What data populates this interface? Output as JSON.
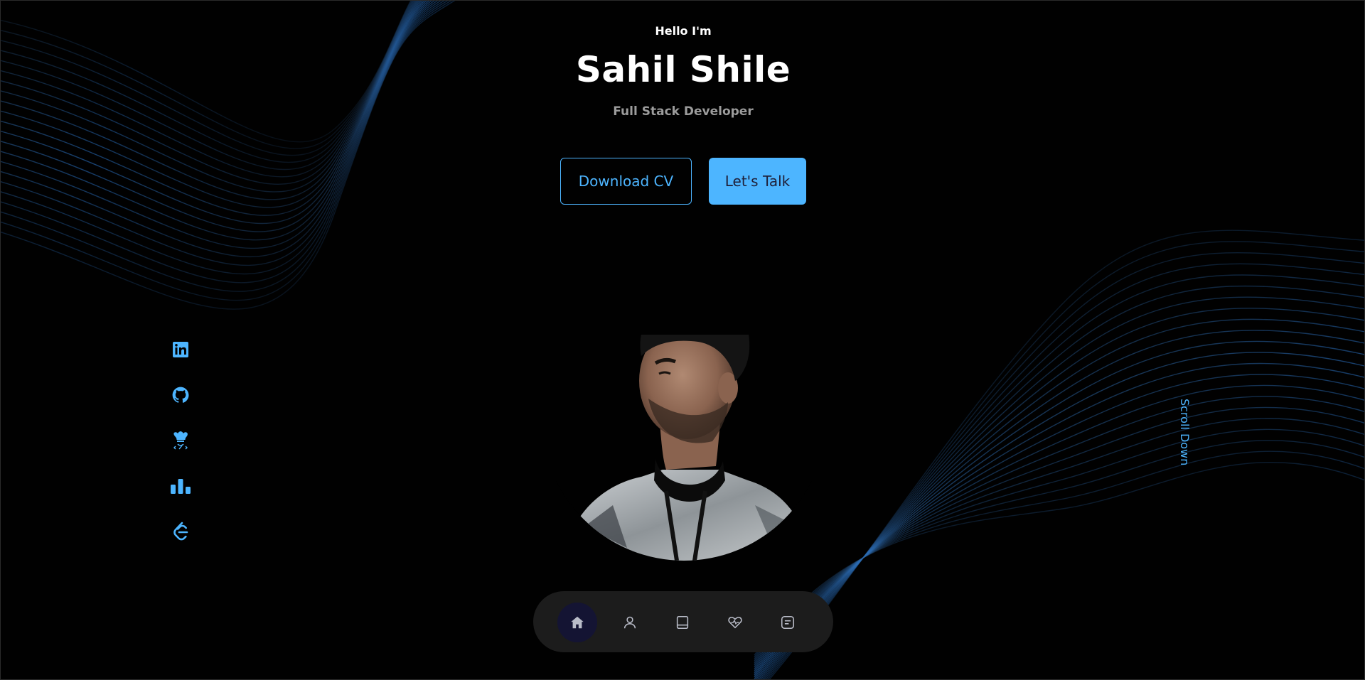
{
  "hero": {
    "greeting": "Hello I'm",
    "name": "Sahil Shile",
    "role": "Full Stack Developer"
  },
  "actions": {
    "download_label": "Download CV",
    "talk_label": "Let's Talk"
  },
  "socials": [
    {
      "icon": "linkedin-icon"
    },
    {
      "icon": "github-icon"
    },
    {
      "icon": "codechef-icon"
    },
    {
      "icon": "bar-chart-icon"
    },
    {
      "icon": "leetcode-icon"
    }
  ],
  "scroll": {
    "label": "Scroll Down"
  },
  "nav": {
    "items": [
      {
        "icon": "home-icon",
        "active": true
      },
      {
        "icon": "user-icon",
        "active": false
      },
      {
        "icon": "book-icon",
        "active": false
      },
      {
        "icon": "services-icon",
        "active": false
      },
      {
        "icon": "message-icon",
        "active": false
      }
    ]
  },
  "colors": {
    "accent": "#4db5ff",
    "background": "#010101",
    "nav_bg": "#1c1c1c",
    "nav_active": "#141433"
  }
}
